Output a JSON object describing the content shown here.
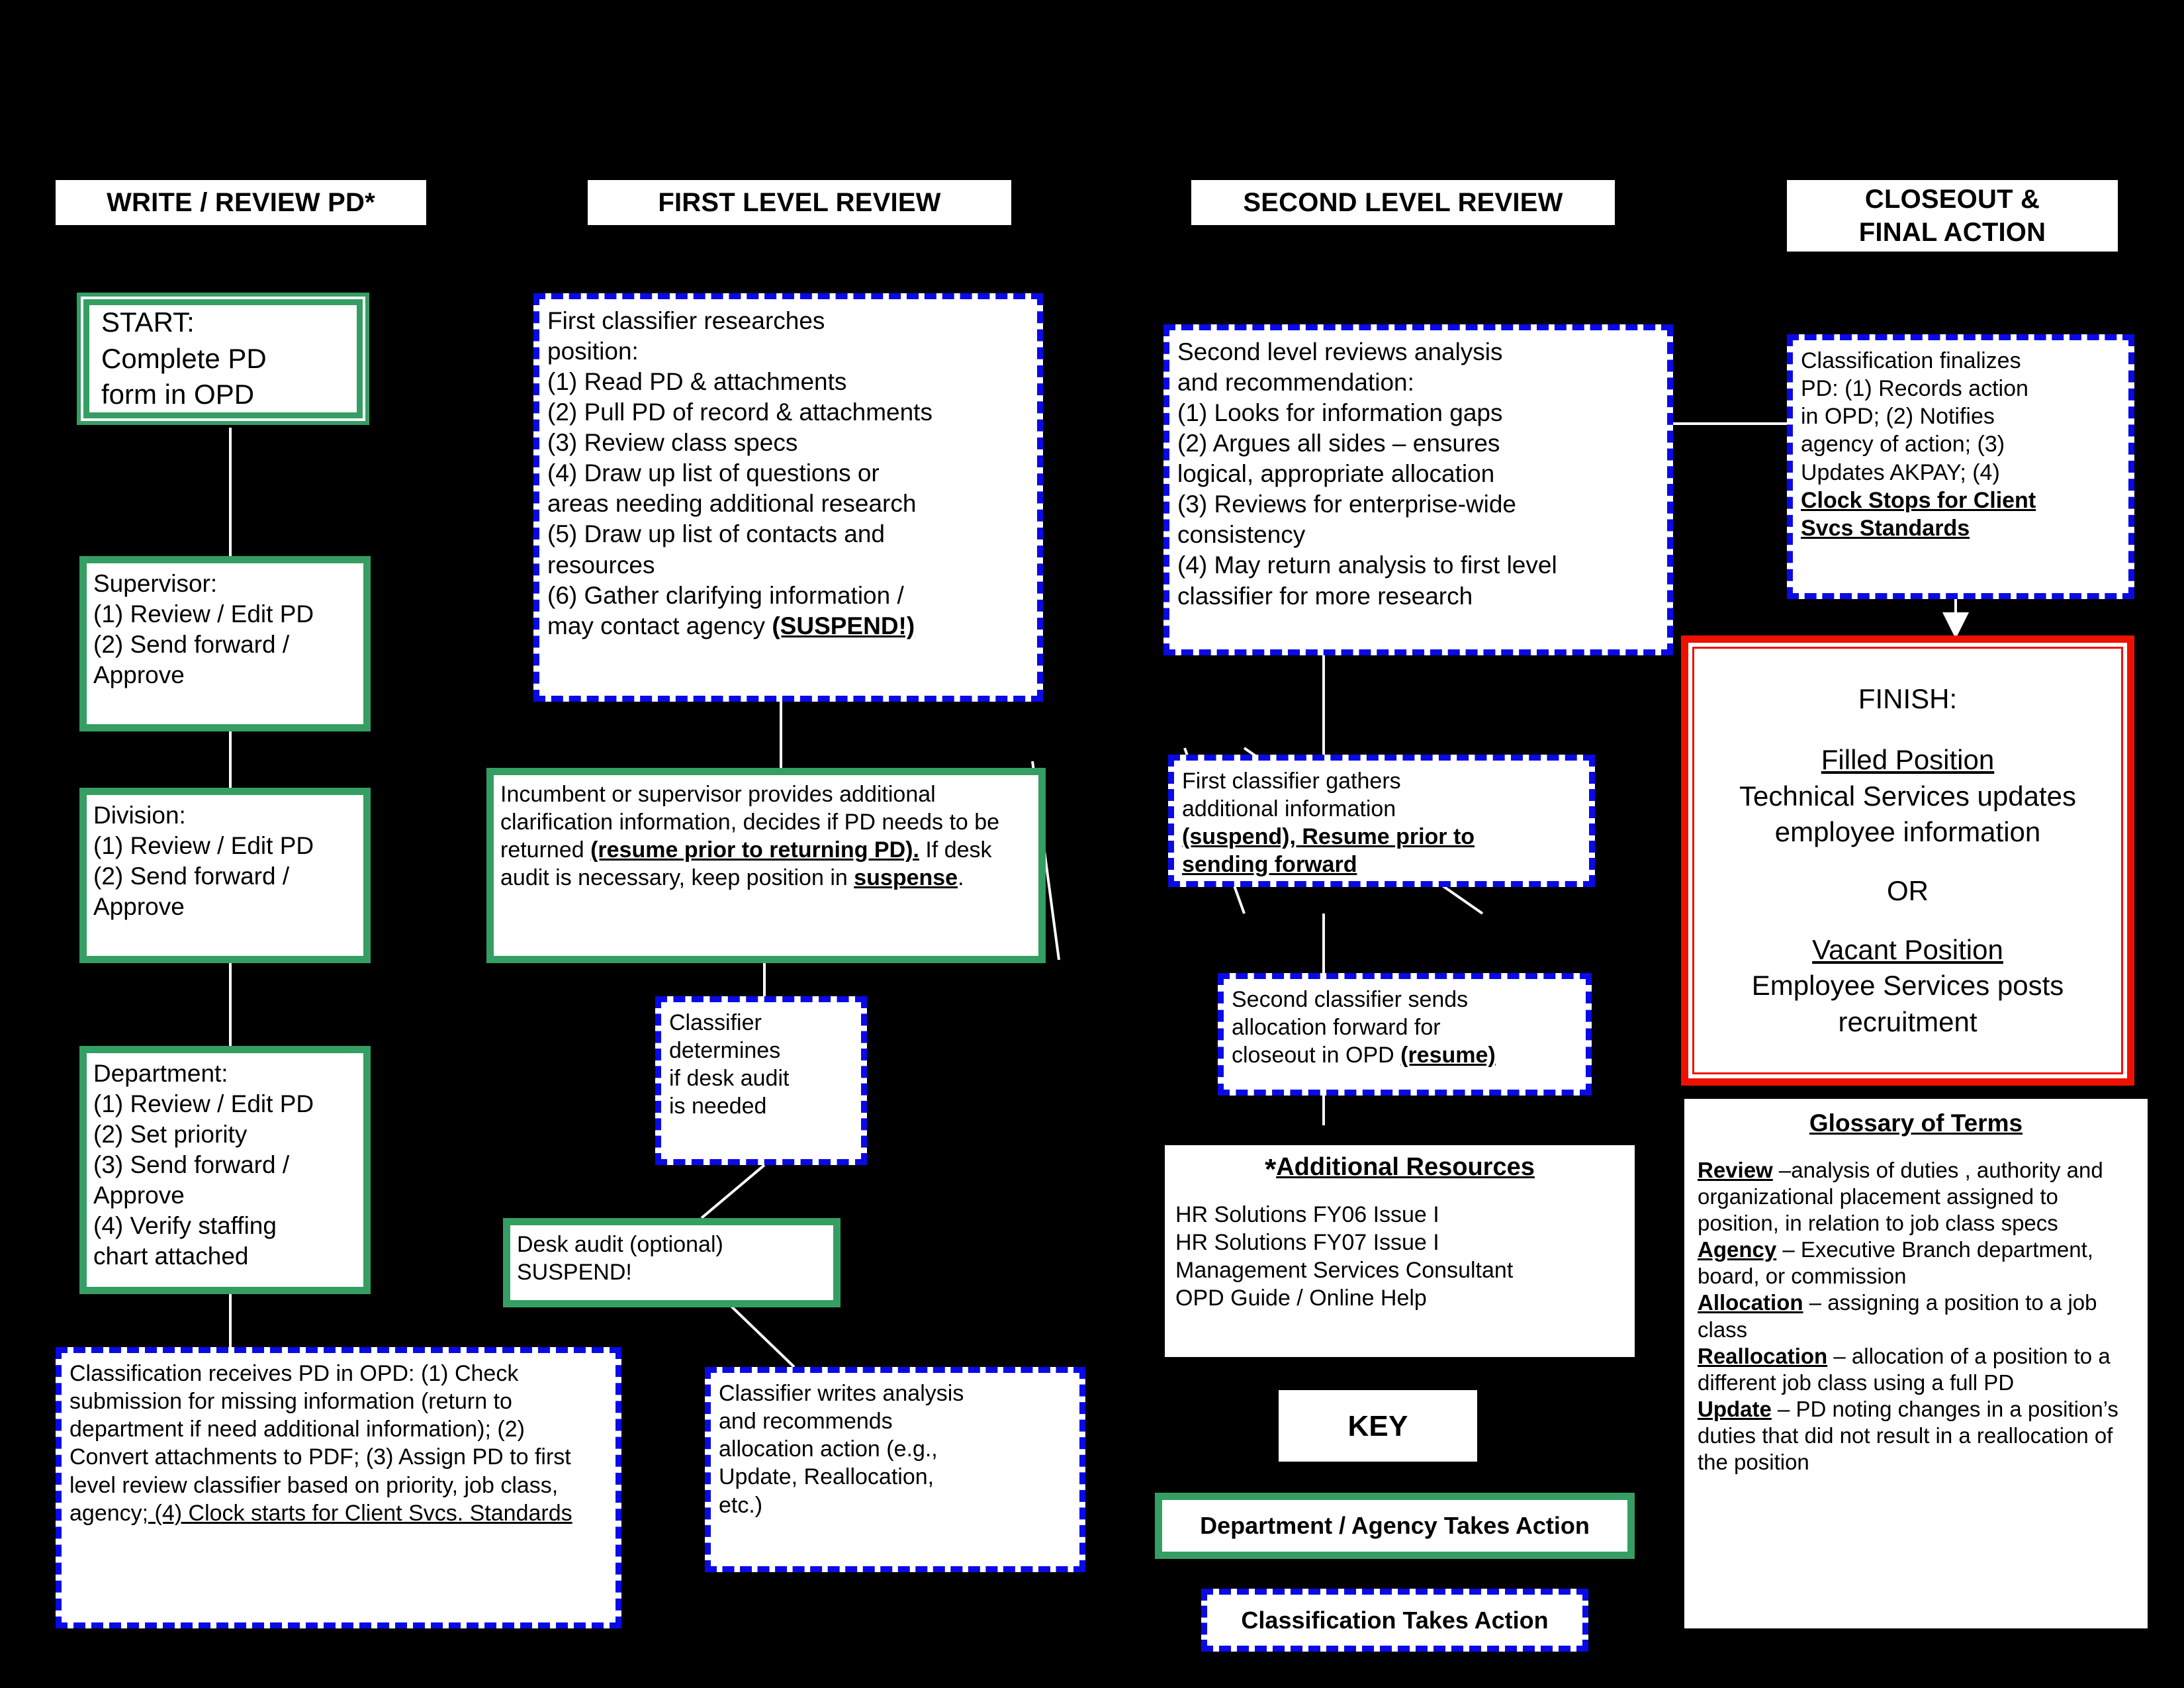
{
  "colors": {
    "background": "#000000",
    "department_green": "#359e63",
    "classification_blue": "#0a0ae6",
    "finish_red": "#f01000",
    "box_fill": "#ffffff",
    "text": "#000000"
  },
  "columns": [
    {
      "header": "WRITE / REVIEW PD*"
    },
    {
      "header": "FIRST LEVEL REVIEW"
    },
    {
      "header": "SECOND LEVEL REVIEW"
    },
    {
      "header": "CLOSEOUT &\nFINAL ACTION"
    }
  ],
  "nodes": {
    "start": "START:\nComplete PD\nform in OPD",
    "supervisor": "Supervisor:\n(1) Review / Edit PD\n(2) Send forward /\nApprove",
    "division": "Division:\n(1) Review / Edit PD\n(2) Send forward /\nApprove",
    "department": "Department:\n(1) Review / Edit PD\n(2) Set priority\n(3) Send forward /\nApprove\n(4) Verify staffing\nchart attached",
    "classification_receives": {
      "plain": "Classification receives PD in OPD: (1) Check submission for missing information (return to department if need additional information); (2) Convert attachments to PDF; (3) Assign PD to first level review classifier based on priority, job class, agency",
      "underlined_tail": ";  (4) Clock starts for Client Svcs. Standards"
    },
    "first_classifier_researches": "First classifier researches\nposition:\n(1) Read PD & attachments\n(2) Pull PD of record & attachments\n(3) Review class specs\n(4) Draw up list of questions or\nareas needing additional research\n(5) Draw up list of contacts and\nresources\n(6) Gather clarifying information /\nmay contact agency ",
    "first_classifier_suspend": "(SUSPEND!)",
    "incumbent": {
      "part1": "Incumbent or supervisor provides additional clarification information, decides if PD needs to be returned ",
      "bold1": "(resume prior to returning PD).",
      "part2": " If desk audit is necessary, keep position in ",
      "bold2": "suspense",
      "part3": "."
    },
    "classifier_determines": "Classifier\ndetermines\nif desk audit\nis needed",
    "desk_audit": "Desk audit (optional)\nSUSPEND!",
    "classifier_writes": "Classifier writes analysis\nand recommends\nallocation action (e.g.,\nUpdate, Reallocation,\netc.)",
    "second_level_reviews": "Second level reviews analysis\nand recommendation:\n(1) Looks for information gaps\n(2) Argues all sides – ensures\nlogical, appropriate allocation\n(3) Reviews for enterprise-wide\nconsistency\n(4) May return analysis to first level\nclassifier for more research",
    "first_classifier_gathers": {
      "part1": "First classifier gathers\nadditional information\n",
      "bold1": "(suspend), Resume prior to\nsending forward"
    },
    "second_classifier_sends": {
      "part1": "Second classifier sends\nallocation forward for\ncloseout in OPD ",
      "bold1": "(resume)"
    },
    "classification_finalizes": {
      "part1": "Classification finalizes\nPD: (1) Records action\nin OPD; (2) Notifies\nagency of action; (3)\nUpdates AKPAY; (4)\n",
      "bold1": "Clock Stops for Client\nSvcs Standards"
    },
    "finish": {
      "title": "FINISH:",
      "sub1": "Filled Position",
      "body1": "Technical Services updates\nemployee information",
      "or": "OR",
      "sub2": "Vacant Position",
      "body2": "Employee Services posts\nrecruitment"
    }
  },
  "additional_resources": {
    "title_star": "*",
    "title": "Additional Resources",
    "items": [
      "HR Solutions FY06 Issue I",
      "HR Solutions FY07 Issue I",
      "Management Services Consultant",
      "OPD Guide / Online Help"
    ]
  },
  "key": {
    "title": "KEY",
    "green_label": "Department / Agency Takes Action",
    "blue_label": "Classification Takes Action"
  },
  "glossary": {
    "title": "Glossary of Terms",
    "entries": [
      {
        "term": "Review",
        "definition": " –analysis of duties , authority and organizational placement assigned to position, in relation to job class specs"
      },
      {
        "term": "Agency",
        "definition": " – Executive Branch department, board, or commission"
      },
      {
        "term": "Allocation",
        "definition": " – assigning a position to a job class"
      },
      {
        "term": "Reallocation",
        "definition": " – allocation of a position to a different job class using a full PD"
      },
      {
        "term": "Update",
        "definition": " – PD noting changes in a position’s duties that did not result in a reallocation of the position"
      }
    ]
  }
}
